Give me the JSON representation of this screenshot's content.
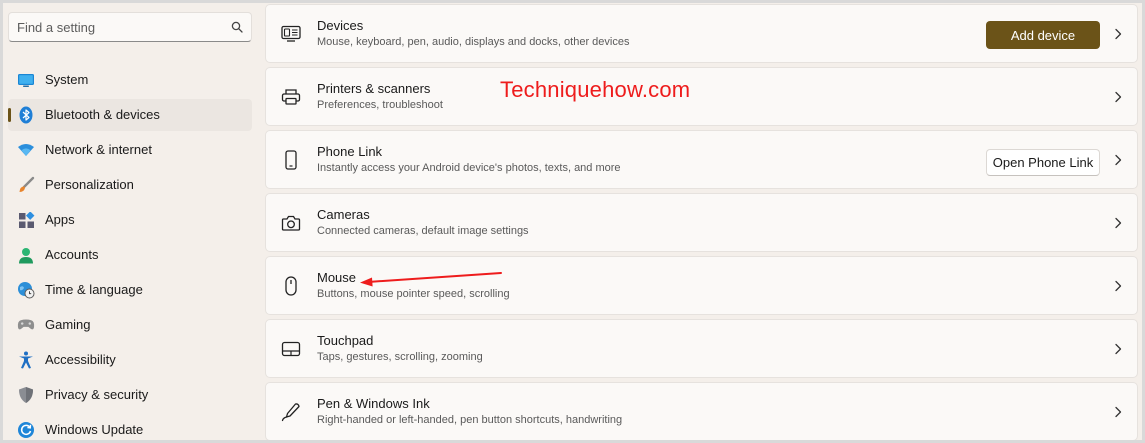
{
  "search": {
    "placeholder": "Find a setting"
  },
  "sidebar": {
    "items": [
      {
        "label": "System",
        "icon": "monitor-icon",
        "active": false
      },
      {
        "label": "Bluetooth & devices",
        "icon": "bluetooth-icon",
        "active": true
      },
      {
        "label": "Network & internet",
        "icon": "wifi-icon",
        "active": false
      },
      {
        "label": "Personalization",
        "icon": "brush-icon",
        "active": false
      },
      {
        "label": "Apps",
        "icon": "apps-icon",
        "active": false
      },
      {
        "label": "Accounts",
        "icon": "person-icon",
        "active": false
      },
      {
        "label": "Time & language",
        "icon": "globe-clock-icon",
        "active": false
      },
      {
        "label": "Gaming",
        "icon": "gamepad-icon",
        "active": false
      },
      {
        "label": "Accessibility",
        "icon": "accessibility-icon",
        "active": false
      },
      {
        "label": "Privacy & security",
        "icon": "shield-icon",
        "active": false
      },
      {
        "label": "Windows Update",
        "icon": "update-icon",
        "active": false
      }
    ]
  },
  "main": {
    "cards": [
      {
        "title": "Devices",
        "subtitle": "Mouse, keyboard, pen, audio, displays and docks, other devices",
        "icon": "devices-icon",
        "button": "Add device"
      },
      {
        "title": "Printers & scanners",
        "subtitle": "Preferences, troubleshoot",
        "icon": "printer-icon"
      },
      {
        "title": "Phone Link",
        "subtitle": "Instantly access your Android device's photos, texts, and more",
        "icon": "phone-icon",
        "button": "Open Phone Link"
      },
      {
        "title": "Cameras",
        "subtitle": "Connected cameras, default image settings",
        "icon": "camera-icon"
      },
      {
        "title": "Mouse",
        "subtitle": "Buttons, mouse pointer speed, scrolling",
        "icon": "mouse-icon"
      },
      {
        "title": "Touchpad",
        "subtitle": "Taps, gestures, scrolling, zooming",
        "icon": "touchpad-icon"
      },
      {
        "title": "Pen & Windows Ink",
        "subtitle": "Right-handed or left-handed, pen button shortcuts, handwriting",
        "icon": "pen-icon"
      }
    ]
  },
  "watermark": "Techniquehow.com",
  "colors": {
    "accent": "#6b5318",
    "annotation": "#ee1c1c",
    "background": "#f4efea"
  }
}
